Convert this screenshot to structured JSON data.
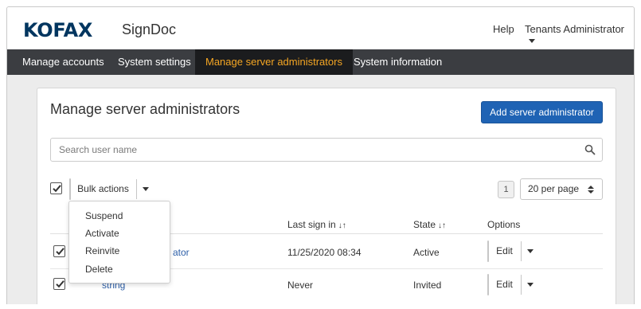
{
  "header": {
    "logo": "KOFAX",
    "app_name": "SignDoc",
    "help": "Help",
    "user_menu": "Tenants Administrator"
  },
  "nav": {
    "items": [
      {
        "label": "Manage accounts",
        "active": false
      },
      {
        "label": "System settings",
        "active": false
      },
      {
        "label": "Manage server administrators",
        "active": true
      },
      {
        "label": "System information",
        "active": false
      }
    ]
  },
  "main": {
    "title": "Manage server administrators",
    "add_button": "Add server administrator",
    "search_placeholder": "Search user name",
    "bulk_actions": "Bulk actions",
    "bulk_menu": [
      "Suspend",
      "Activate",
      "Reinvite",
      "Delete"
    ],
    "page_number": "1",
    "per_page": "20 per page",
    "columns": {
      "last_sign_in": "Last sign in",
      "state": "State",
      "options": "Options"
    },
    "rows": [
      {
        "name_visible": "ator",
        "last_sign_in": "11/25/2020 08:34",
        "state": "Active",
        "edit": "Edit",
        "checked": true
      },
      {
        "name_visible": "string",
        "last_sign_in": "Never",
        "state": "Invited",
        "edit": "Edit",
        "checked": true
      }
    ]
  },
  "colors": {
    "brand": "#00355f",
    "nav_bg": "#3b3d41",
    "nav_active_text": "#f5a623",
    "primary_button": "#1f63b4",
    "link": "#2d5fa8"
  }
}
